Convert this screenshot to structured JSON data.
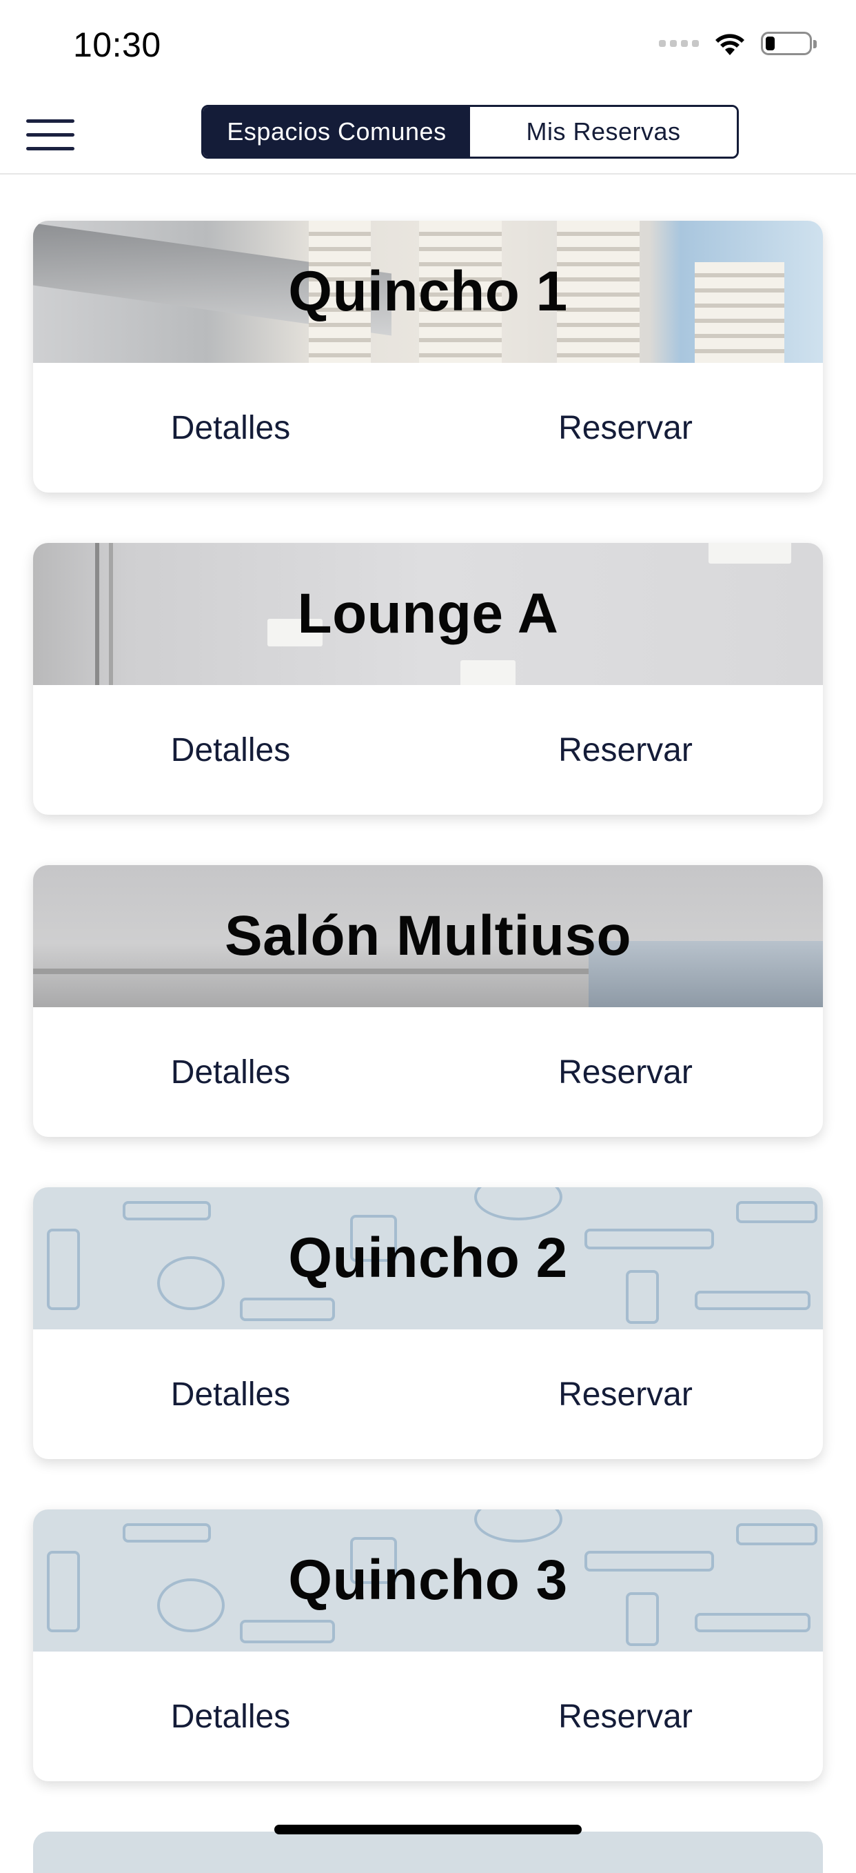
{
  "status_bar": {
    "time": "10:30",
    "icons": [
      "signal-dots-icon",
      "wifi-icon",
      "battery-icon"
    ],
    "battery_level": 0.15
  },
  "nav": {
    "menu_icon": "hamburger-menu-icon",
    "tabs": [
      {
        "label": "Espacios Comunes",
        "active": true
      },
      {
        "label": "Mis Reservas",
        "active": false
      }
    ]
  },
  "colors": {
    "accent": "#141c38",
    "background": "#ffffff",
    "pattern_bg": "#d4dde3"
  },
  "cards": [
    {
      "title": "Quincho 1",
      "details_label": "Detalles",
      "reserve_label": "Reservar",
      "image": "building-photo"
    },
    {
      "title": "Lounge A",
      "details_label": "Detalles",
      "reserve_label": "Reservar",
      "image": "ceiling-photo"
    },
    {
      "title": "Salón Multiuso",
      "details_label": "Detalles",
      "reserve_label": "Reservar",
      "image": "room-photo"
    },
    {
      "title": "Quincho 2",
      "details_label": "Detalles",
      "reserve_label": "Reservar",
      "image": "bbq-pattern"
    },
    {
      "title": "Quincho 3",
      "details_label": "Detalles",
      "reserve_label": "Reservar",
      "image": "bbq-pattern"
    }
  ]
}
